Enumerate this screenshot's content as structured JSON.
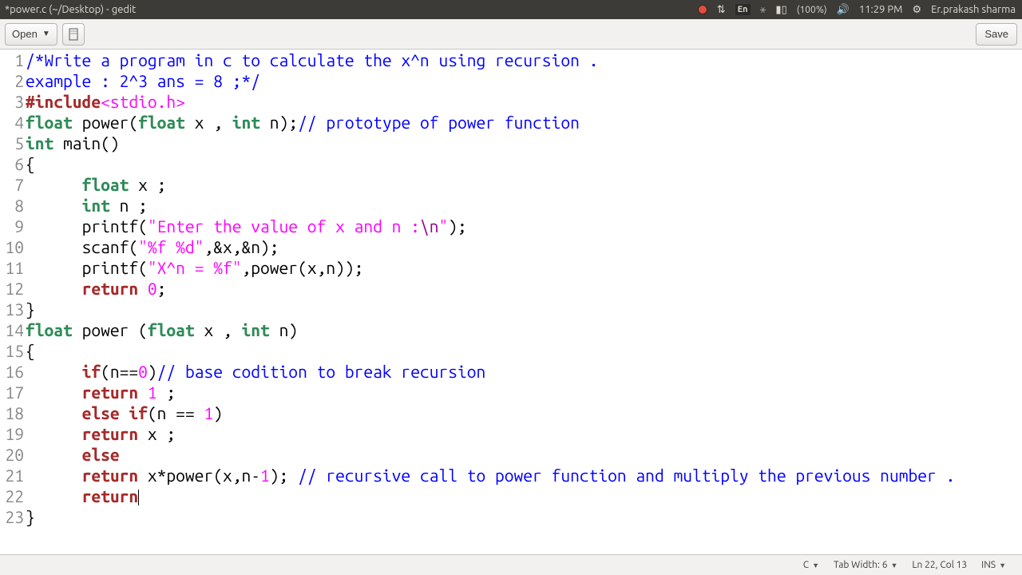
{
  "menubar": {
    "title": "*power.c (~/Desktop) - gedit",
    "lang": "En",
    "battery": "(100%)",
    "time": "11:29 PM",
    "user": "Er.prakash sharma"
  },
  "toolbar": {
    "open_label": "Open",
    "save_label": "Save"
  },
  "statusbar": {
    "language": "C",
    "tabwidth": "Tab Width: 6",
    "position": "Ln 22, Col 13",
    "ins": "INS"
  },
  "code": {
    "l1": {
      "comment": "/*Write a program in c to calculate the x^n using recursion ."
    },
    "l2": {
      "comment": "example : 2^3 ans = 8 ;*/"
    },
    "l3": {
      "pre_kw": "#include",
      "pre_rest": "<stdio.h>"
    },
    "l4": {
      "type1": "float",
      "t1": " power(",
      "type2": "float",
      "t2": " x , ",
      "type3": "int",
      "t3": " n);",
      "comment": "// prototype of power function"
    },
    "l5": {
      "type1": "int",
      "t1": " main()"
    },
    "l6": {
      "t": "{"
    },
    "l7": {
      "pad": "      ",
      "type1": "float",
      "t1": " x ;"
    },
    "l8": {
      "pad": "      ",
      "type1": "int",
      "t1": " n ;"
    },
    "l9": {
      "pad": "      ",
      "t1": "printf(",
      "str": "\"Enter the value of x and n :",
      "esc": "\\n",
      "strend": "\"",
      "t2": ");"
    },
    "l10": {
      "pad": "      ",
      "t1": "scanf(",
      "str": "\"%f %d\"",
      "t2": ",&x,&n);"
    },
    "l11": {
      "pad": "      ",
      "t1": "printf(",
      "str": "\"X^n = %f\"",
      "t2": ",power(x,n));"
    },
    "l12": {
      "pad": "      ",
      "kw": "return",
      "t1": " ",
      "num": "0",
      "t2": ";"
    },
    "l13": {
      "t": "}"
    },
    "l14": {
      "type1": "float",
      "t1": " power (",
      "type2": "float",
      "t2": " x , ",
      "type3": "int",
      "t3": " n)"
    },
    "l15": {
      "t": "{"
    },
    "l16": {
      "pad": "      ",
      "kw": "if",
      "t1": "(n==",
      "num": "0",
      "t2": ")",
      "comment": "// base codition to break recursion"
    },
    "l17": {
      "pad": "      ",
      "kw": "return",
      "t1": " ",
      "num": "1",
      "t2": " ;"
    },
    "l18": {
      "pad": "      ",
      "kw1": "else",
      "t1": " ",
      "kw2": "if",
      "t2": "(n == ",
      "num": "1",
      "t3": ")"
    },
    "l19": {
      "pad": "      ",
      "kw": "return",
      "t1": " x ;"
    },
    "l20": {
      "pad": "      ",
      "kw": "else"
    },
    "l21": {
      "pad": "      ",
      "kw": "return",
      "t1": " x*power(x,n-",
      "num": "1",
      "t2": "); ",
      "comment": "// recursive call to power function and multiply the previous number ."
    },
    "l22": {
      "pad": "      ",
      "kw": "return"
    },
    "l23": {
      "t": "}"
    }
  }
}
